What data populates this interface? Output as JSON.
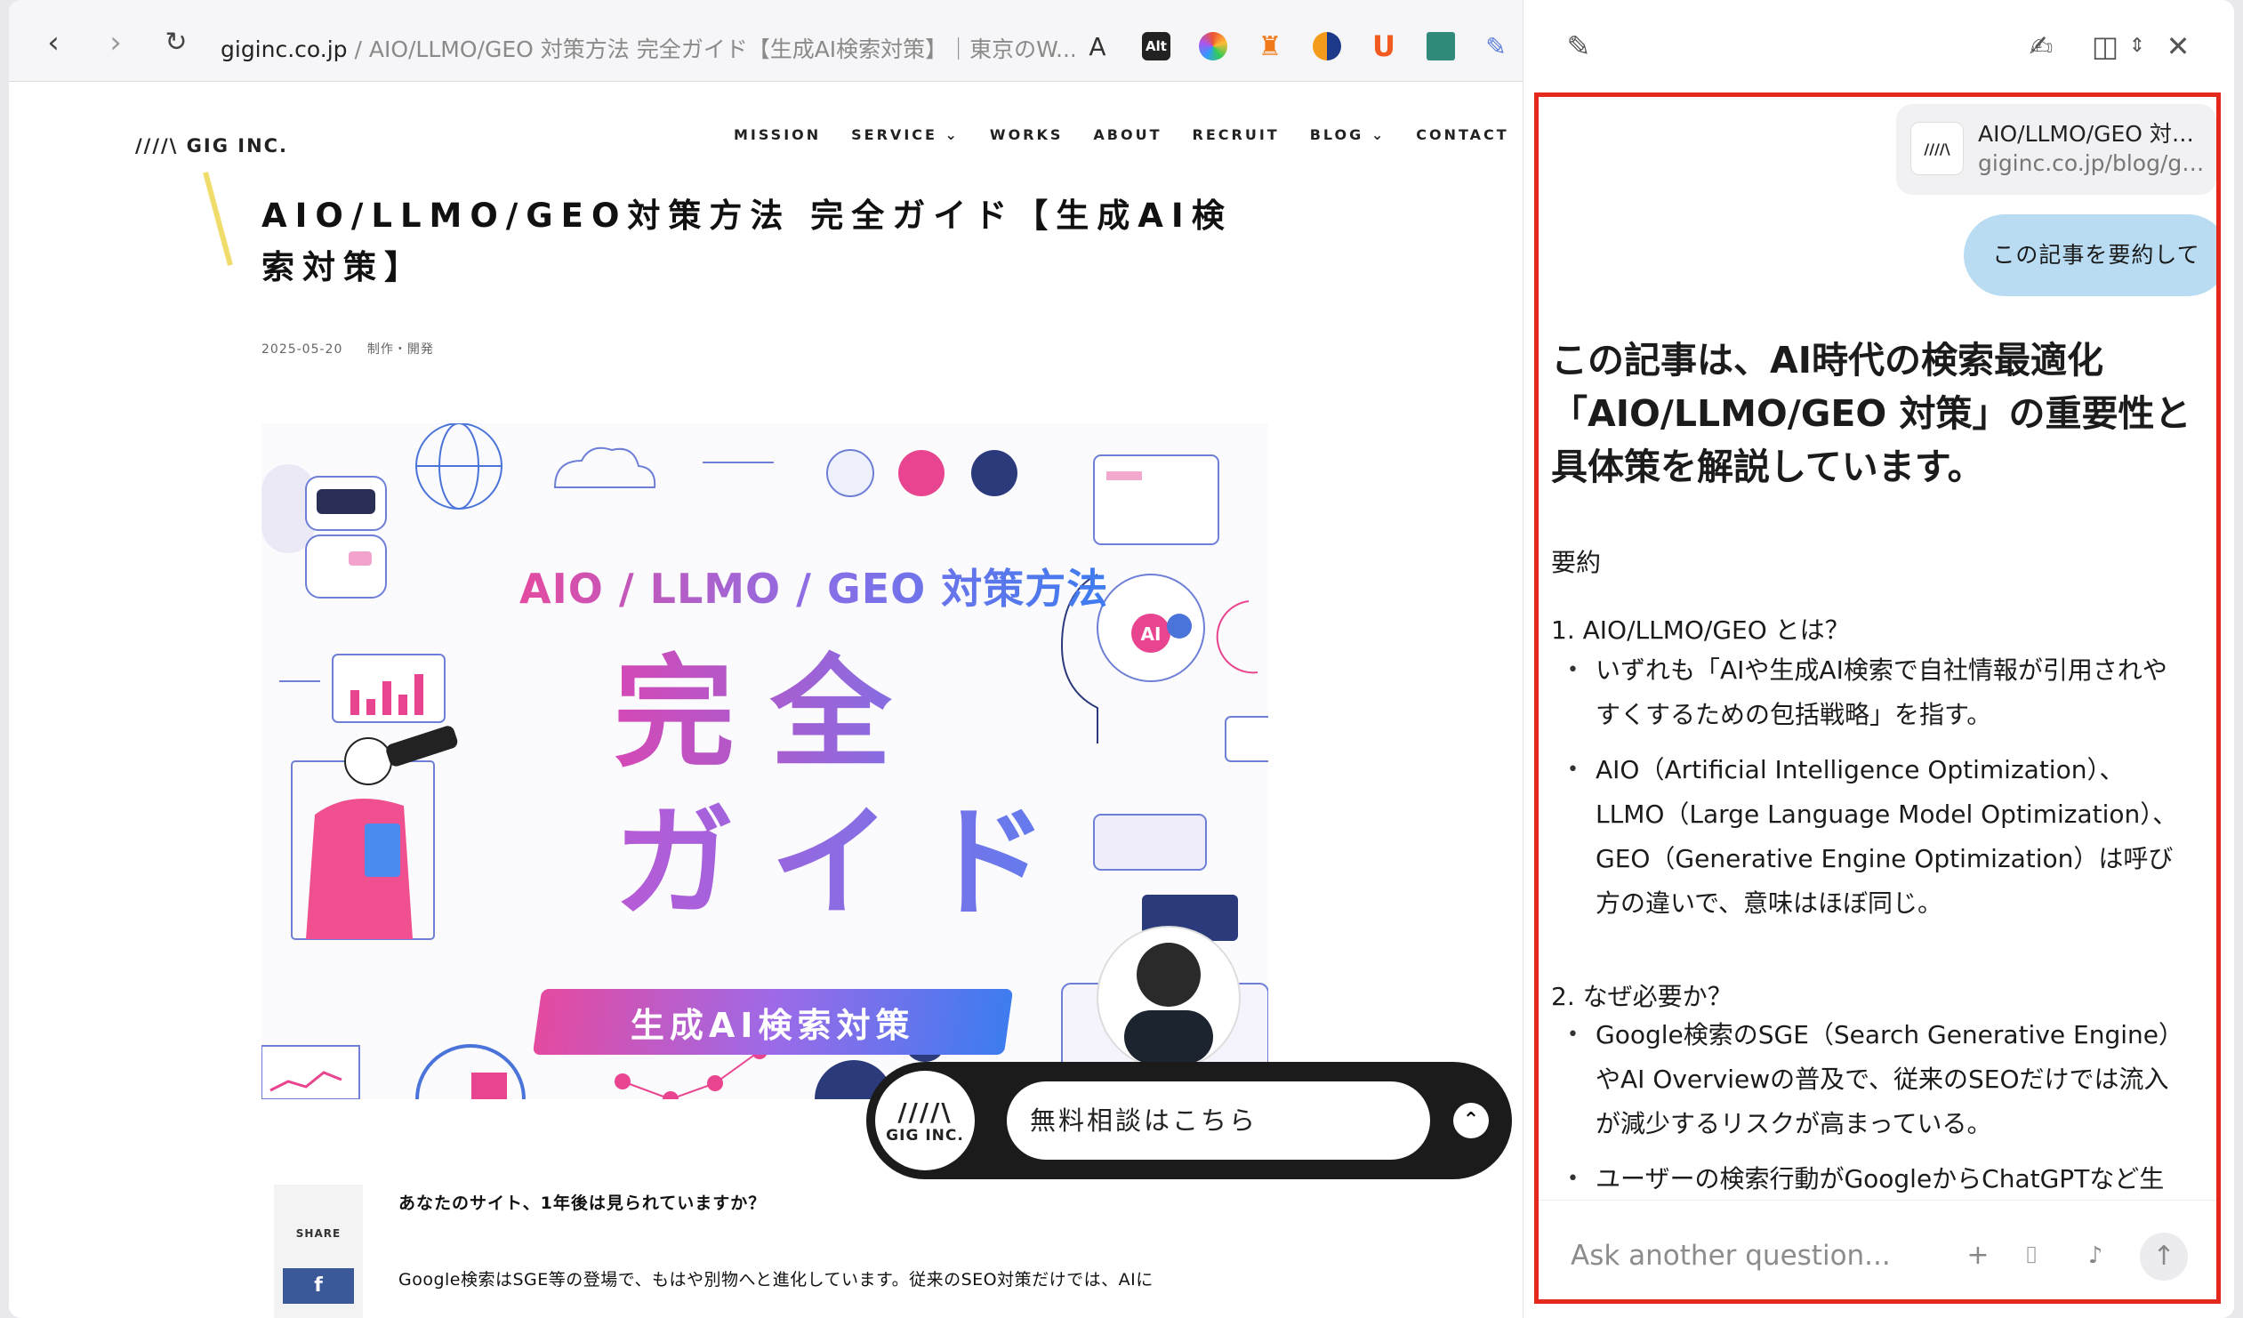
{
  "browser": {
    "url_host": "giginc.co.jp",
    "url_rest": " / AIO/LLMO/GEO 対策方法 完全ガイド【生成AI検索対策】｜東京のW...",
    "back_icon": "‹",
    "forward_icon": "›",
    "reload_icon": "↻",
    "extensions": [
      "translate-icon",
      "alt-text-icon",
      "color-wheel-icon",
      "orange-figure-icon",
      "half-circle-icon",
      "u-icon",
      "teal-square-icon",
      "notes-icon"
    ]
  },
  "site": {
    "logo": "////\\ GIG INC.",
    "nav": [
      "MISSION",
      "SERVICE",
      "WORKS",
      "ABOUT",
      "RECRUIT",
      "BLOG",
      "CONTACT"
    ],
    "nav_dropdowns": [
      "SERVICE",
      "BLOG"
    ]
  },
  "article": {
    "title": "AIO/LLMO/GEO対策方法 完全ガイド【生成AI検索対策】",
    "date": "2025-05-20",
    "category": "制作・開発",
    "hero_subtitle": "AIO / LLMO / GEO 対策方法",
    "hero_big_line1": "完全",
    "hero_big_line2": "ガイド",
    "hero_band": "生成AI検索対策",
    "share_label": "SHARE",
    "facebook_label": "f",
    "lead": "あなたのサイト、1年後は見られていますか？",
    "body": "Google検索はSGE等の登場で、もはや別物へと進化しています。従来のSEO対策だけでは、AIに"
  },
  "consult_widget": {
    "logo_text": "GIG INC.",
    "label": "無料相談はこちら",
    "toggle_icon": "^"
  },
  "sidebar": {
    "ref_title": "AIO/LLMO/GEO 対…",
    "ref_url": "giginc.co.jp/blog/gi...",
    "user_message": "この記事を要約して",
    "answer_headline": "この記事は、AI時代の検索最適化「AIO/LLMO/GEO 対策」の重要性と具体策を解説しています。",
    "summary_label": "要約",
    "sections": [
      {
        "heading": "1. AIO/LLMO/GEO とは？",
        "bullets": [
          "いずれも「AIや生成AI検索で自社情報が引用されやすくするための包括戦略」を指す。",
          "AIO（Artificial Intelligence Optimization）、LLMO（Large Language Model Optimization）、GEO（Generative Engine Optimization）は呼び方の違いで、意味はほぼ同じ。"
        ]
      },
      {
        "heading": "2. なぜ必要か？",
        "bullets": [
          "Google検索のSGE（Search Generative Engine）やAI Overviewの普及で、従来のSEOだけでは流入が減少するリスクが高まっている。",
          "ユーザーの検索行動がGoogleからChatGPTなど生"
        ]
      }
    ],
    "ask_placeholder": "Ask another question...",
    "accent_color": "#e5281c"
  }
}
